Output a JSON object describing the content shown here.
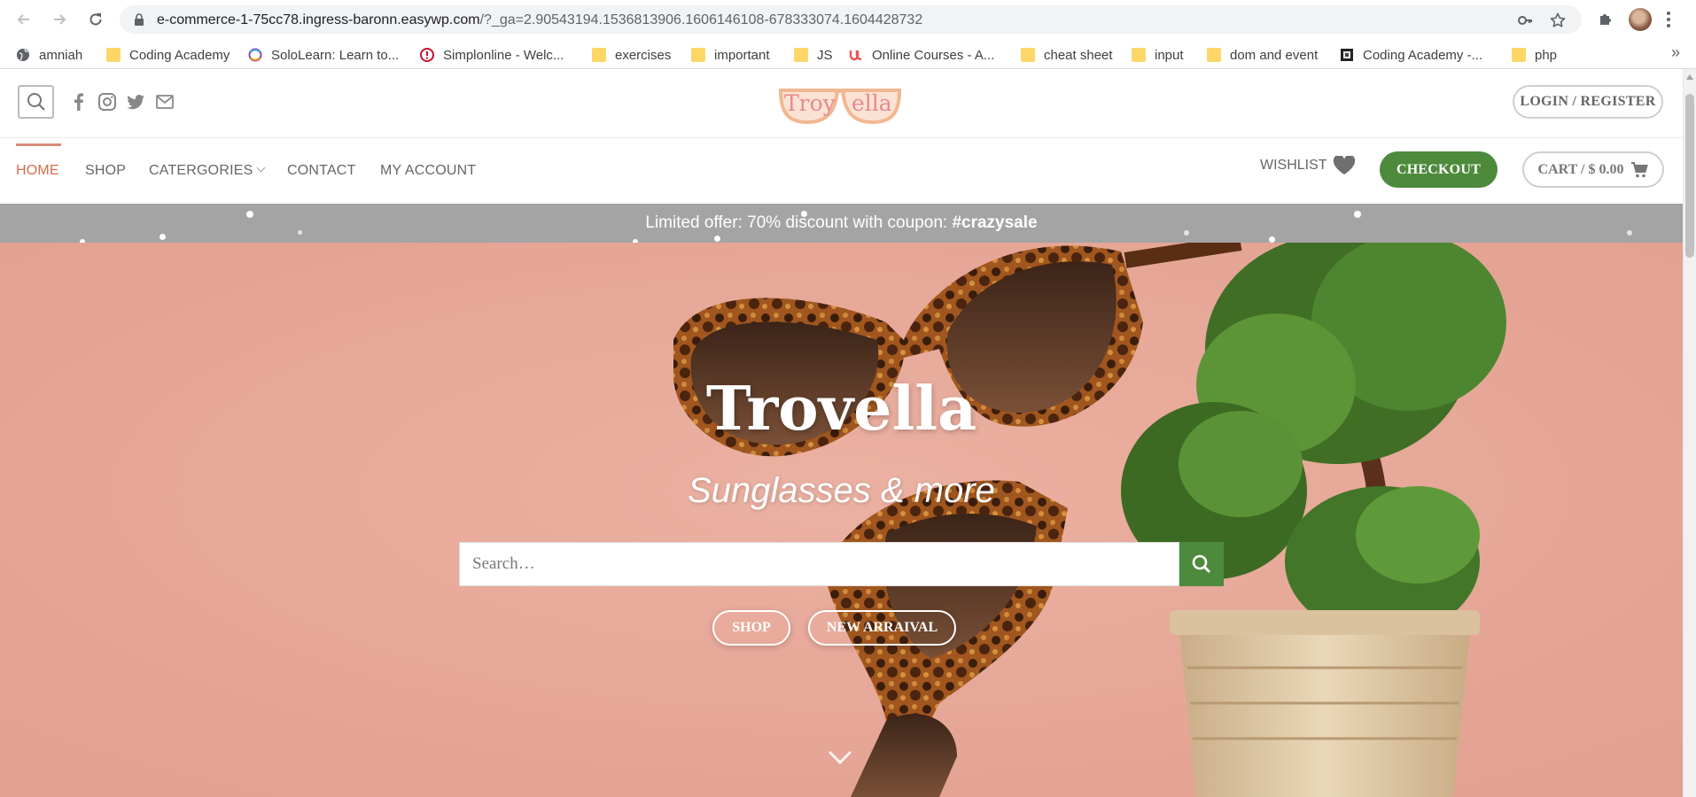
{
  "browser": {
    "url_host": "e-commerce-1-75cc78.ingress-baronn.easywp.com",
    "url_path": "/?_ga=2.90543194.1536813906.1606146108-678333074.1604428732",
    "bookmarks": [
      {
        "label": "amniah",
        "icon": "globe-icon"
      },
      {
        "label": "Coding Academy",
        "icon": "folder-icon"
      },
      {
        "label": "SoloLearn: Learn to...",
        "icon": "sololearn-icon"
      },
      {
        "label": "Simplonline - Welc...",
        "icon": "simplon-icon"
      },
      {
        "label": "exercises",
        "icon": "folder-icon"
      },
      {
        "label": "important",
        "icon": "folder-icon"
      },
      {
        "label": "JS",
        "icon": "folder-icon"
      },
      {
        "label": "Online Courses - A...",
        "icon": "udemy-icon"
      },
      {
        "label": "cheat sheet",
        "icon": "folder-icon"
      },
      {
        "label": "input",
        "icon": "folder-icon"
      },
      {
        "label": "dom and event",
        "icon": "folder-icon"
      },
      {
        "label": "Coding Academy -...",
        "icon": "page-icon"
      },
      {
        "label": "php",
        "icon": "folder-icon"
      }
    ],
    "more_label": "»"
  },
  "header": {
    "logo_text_left": "Troy",
    "logo_text_right": "ella",
    "login_label": "LOGIN / REGISTER"
  },
  "nav": {
    "items": [
      "HOME",
      "SHOP",
      "CATERGORIES",
      "CONTACT",
      "MY ACCOUNT"
    ],
    "active": "HOME",
    "wishlist_label": "WISHLIST",
    "checkout_label": "CHECKOUT",
    "cart_label": "CART / $ 0.00"
  },
  "promo": {
    "text": "Limited offer: 70% discount with coupon: ",
    "coupon": "#crazysale"
  },
  "hero": {
    "title": "Trovella",
    "subtitle": "Sunglasses & more",
    "search_placeholder": "Search…",
    "buttons": [
      "SHOP",
      "NEW ARRAIVAL"
    ]
  },
  "colors": {
    "accent": "#d26e4b",
    "green": "#4d8a3c",
    "promo_bg": "#a4a4a4",
    "hero_bg": "#e6a999"
  }
}
